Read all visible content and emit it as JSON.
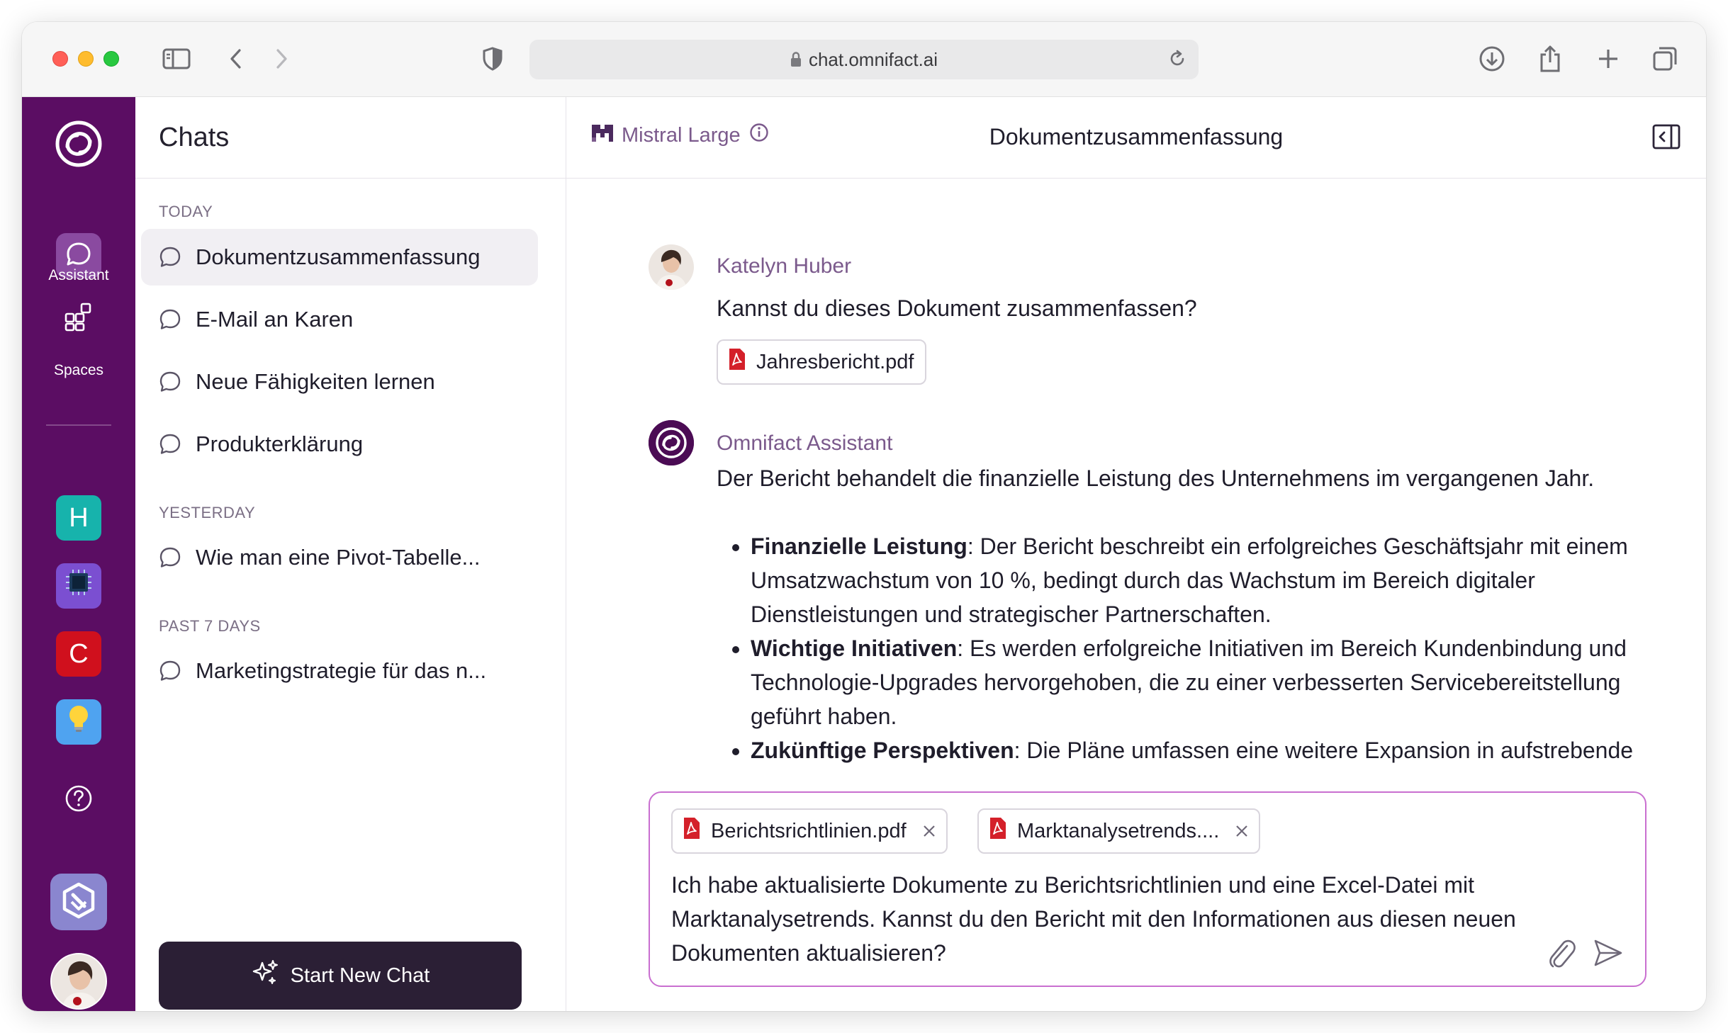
{
  "browser": {
    "url": "chat.omnifact.ai"
  },
  "rail": {
    "assistant_label": "Assistant",
    "spaces_label": "Spaces",
    "spaces": [
      {
        "letter": "H",
        "color": "#17b3ac"
      },
      {
        "letter": "",
        "color": "#7b4fd1"
      },
      {
        "letter": "C",
        "color": "#d0101d"
      },
      {
        "letter": "",
        "color": "#4fa3f0"
      }
    ],
    "help_icon": "question-circle-icon"
  },
  "sidebar": {
    "title": "Chats",
    "sections": [
      {
        "label": "TODAY",
        "items": [
          "Dokumentzusammenfassung",
          "E-Mail an Karen",
          "Neue Fähigkeiten lernen",
          "Produkterklärung"
        ]
      },
      {
        "label": "YESTERDAY",
        "items": [
          "Wie man eine Pivot-Tabelle..."
        ]
      },
      {
        "label": "PAST 7 DAYS",
        "items": [
          "Marketingstrategie für das n..."
        ]
      }
    ],
    "new_chat_label": "Start New Chat"
  },
  "header": {
    "model": "Mistral Large",
    "title": "Dokumentzusammenfassung"
  },
  "messages": {
    "user": {
      "name": "Katelyn Huber",
      "text": "Kannst du dieses Dokument zusammenfassen?",
      "attachment": "Jahresbericht.pdf"
    },
    "assistant": {
      "name": "Omnifact Assistant",
      "intro": "Der Bericht behandelt die finanzielle Leistung des Unternehmens im vergangenen Jahr.",
      "bullets": [
        {
          "title": "Finanzielle Leistung",
          "text": ": Der Bericht beschreibt ein erfolgreiches Geschäftsjahr mit einem Umsatzwachstum von 10 %, bedingt durch das Wachstum im Bereich digitaler Dienstleistungen und strategischer Partnerschaften."
        },
        {
          "title": "Wichtige Initiativen",
          "text": ": Es werden erfolgreiche Initiativen im Bereich Kundenbindung und Technologie-Upgrades hervorgehoben, die zu einer verbesserten Servicebereitstellung geführt haben."
        },
        {
          "title": "Zukünftige Perspektiven",
          "text": ": Die Pläne umfassen eine weitere Expansion in aufstrebende Märkte und fortlaufende Investitionen in Innovationen."
        }
      ]
    }
  },
  "composer": {
    "attachments": [
      "Berichtsrichtlinien.pdf",
      "Marktanalysetrends...."
    ],
    "text": "Ich habe aktualisierte Dokumente zu Berichtsrichtlinien und eine Excel-Datei mit Marktanalysetrends. Kannst du den Bericht mit den Informationen aus diesen neuen Dokumenten aktualisieren?"
  },
  "colors": {
    "rail": "#5b0d63",
    "accent": "#7b5a8c",
    "composer_border": "#c96fd0",
    "new_chat_bg": "#2b1f35",
    "pdf_red": "#d4202a"
  }
}
